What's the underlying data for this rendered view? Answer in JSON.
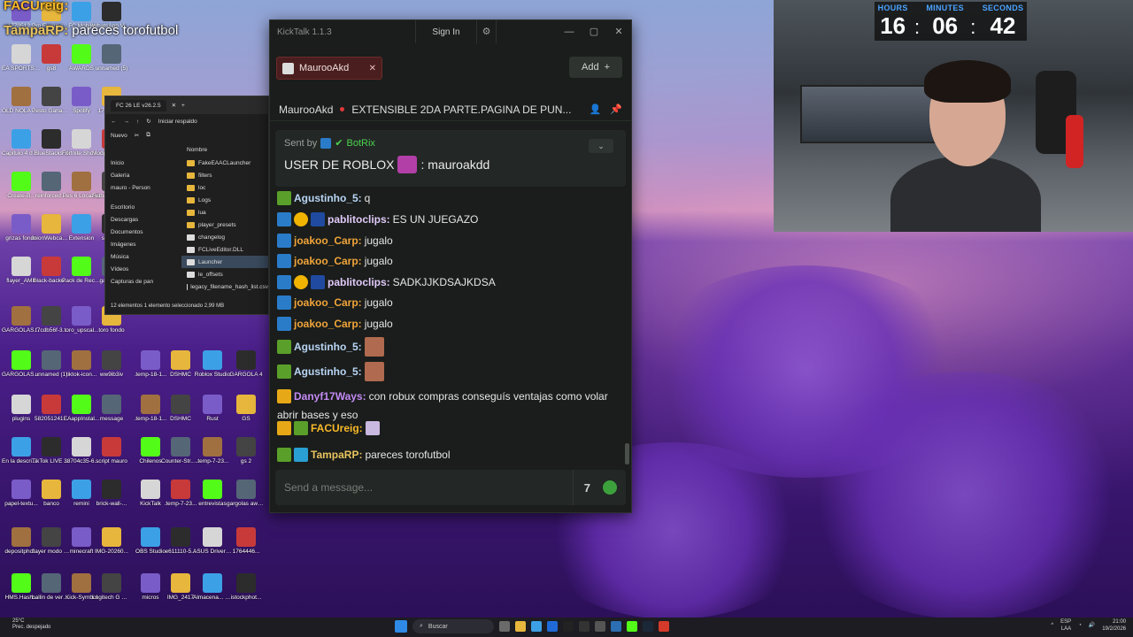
{
  "overlay": {
    "line1": {
      "name": "FACUreig:",
      "msg": ""
    },
    "line2": {
      "name": "TampaRP:",
      "msg": "parecesbtorofutbol"
    }
  },
  "desktop_icons": [
    {
      "label": "1770512..."
    },
    {
      "label": "Pro Evolution Soccer 6"
    },
    {
      "label": "FC Mobile"
    },
    {
      "label": "WhatsApp Video 2025..."
    },
    {
      "label": "EA SPORTS FC 26"
    },
    {
      "label": "gs8"
    },
    {
      "label": "AWARDS"
    },
    {
      "label": "unnamed (5)"
    },
    {
      "label": "OLD NOLA Streams"
    },
    {
      "label": "Pesto Ganadero"
    },
    {
      "label": "Spotify"
    },
    {
      "label": "1770512..."
    },
    {
      "label": "Capitulo 4 de patoamon..."
    },
    {
      "label": "BlueStacks X"
    },
    {
      "label": "Fortnite Shortcut"
    },
    {
      "label": "Modpack-HD ..."
    },
    {
      "label": "Create-B..."
    },
    {
      "label": "reinforced ..."
    },
    {
      "label": "Pes 6 Locazos"
    },
    {
      "label": "Futball x3 by Bazinga Fro..."
    },
    {
      "label": "grizas fondo"
    },
    {
      "label": "InionWebcam..."
    },
    {
      "label": "Extension"
    },
    {
      "label": "sg mice"
    },
    {
      "label": "flayer_AME"
    },
    {
      "label": "black-backu..."
    },
    {
      "label": "Pack de Recursos ..."
    },
    {
      "label": "gargola 2"
    },
    {
      "label": "GARGOLAS AWARD"
    },
    {
      "label": "f7cdb56f-3..."
    },
    {
      "label": "toro_upscal..."
    },
    {
      "label": "toro fondo"
    },
    {
      "label": ".temp-14-1..."
    },
    {
      "label": "kicktalk"
    },
    {
      "label": "pelicula l..."
    },
    {
      "label": "GARGOLA 3"
    },
    {
      "label": "GARGOLAS AWARSD"
    },
    {
      "label": "unnamed (1)"
    },
    {
      "label": "tiktok-icon..."
    },
    {
      "label": "ww9ib3iv"
    },
    {
      "label": ".temp-18-1..."
    },
    {
      "label": "DSHMC"
    },
    {
      "label": "Roblox Studio"
    },
    {
      "label": "GARGOLA 4"
    },
    {
      "label": "plugins"
    },
    {
      "label": "582051241..."
    },
    {
      "label": "EAappInstal..."
    },
    {
      "label": "message"
    },
    {
      "label": ".temp-18-1..."
    },
    {
      "label": "DSHMC"
    },
    {
      "label": "Rust"
    },
    {
      "label": "GS"
    },
    {
      "label": "En la descripció..."
    },
    {
      "label": "TikTok LIVE Studio"
    },
    {
      "label": "38704c35-6..."
    },
    {
      "label": "script mauro"
    },
    {
      "label": "Chilenos"
    },
    {
      "label": "Counter-Str... 2"
    },
    {
      "label": ".temp-7-23..."
    },
    {
      "label": "gs 2"
    },
    {
      "label": "papel-textu..."
    },
    {
      "label": "banco"
    },
    {
      "label": "remini"
    },
    {
      "label": "brick-wall-..."
    },
    {
      "label": "KickTalk"
    },
    {
      "label": ".temp-7-23..."
    },
    {
      "label": "entrevistas"
    },
    {
      "label": "gargolas awards"
    },
    {
      "label": "depositpho..."
    },
    {
      "label": "flayer modo carrera"
    },
    {
      "label": "minecraft"
    },
    {
      "label": "IMG-20260..."
    },
    {
      "label": "OBS Studio"
    },
    {
      "label": "e611110-5..."
    },
    {
      "label": "ASUS DriverHub"
    },
    {
      "label": "1764446..."
    },
    {
      "label": "HMS.Hash..."
    },
    {
      "label": "ballin de verdad"
    },
    {
      "label": "Kick-Symbol"
    },
    {
      "label": "Logitech G HUB"
    },
    {
      "label": "micros"
    },
    {
      "label": "IMG_2417"
    },
    {
      "label": "Almacena... automátic..."
    },
    {
      "label": "istockphot..."
    },
    {
      "label": "bcb2d2a5-8..."
    },
    {
      "label": "BlueStacks Multi-Insta..."
    },
    {
      "label": "al the stars mate.acd"
    },
    {
      "label": "flayer"
    },
    {
      "label": "EpicInstalle..."
    },
    {
      "label": "Steam"
    },
    {
      "label": "unnamed (3)_upscayl..."
    },
    {
      "label": "CurseForge Installer"
    },
    {
      "label": "camisetas gargolas"
    }
  ],
  "explorer": {
    "tab_label": "FC 26 LE v26.2.5",
    "address": "Iniciar respaldo",
    "new_label": "Nuevo",
    "column_header": "Nombre",
    "sidebar": [
      "Inicio",
      "Galería",
      "mauro - Person",
      "Escritorio",
      "Descargas",
      "Documentos",
      "Imágenes",
      "Música",
      "Vídeos",
      "Capturas de pan"
    ],
    "files": [
      "FakeEAACLauncher",
      "filters",
      "loc",
      "Logs",
      "lua",
      "player_presets",
      "changelog",
      "FCLiveEditor.DLL",
      "Launcher",
      "le_offsets",
      "legacy_filename_hash_list.csv"
    ],
    "status": "12 elementos    1 elemento seleccionado  2,99 MB"
  },
  "kicktalk": {
    "title": "KickTalk 1.1.3",
    "signin": "Sign In",
    "tab": "MaurooAkd",
    "add": "Add",
    "stream_user": "MaurooAkd",
    "stream_title": "EXTENSIBLE 2DA PARTE.PAGINA DE PUN...",
    "pinned": {
      "sent_by": "Sent by",
      "bot": "BotRix",
      "msg_pre": "USER DE ROBLOX",
      "msg_post": ": mauroakdd"
    },
    "messages": [
      {
        "user": "Agustinho_5:",
        "text": "q",
        "color": "#b9d5f5"
      },
      {
        "user": "pablitoclips:",
        "text": "ES UN JUEGAZO",
        "color": "#e0c8f8"
      },
      {
        "user": "joakoo_Carp:",
        "text": "jugalo",
        "color": "#f0a43a"
      },
      {
        "user": "joakoo_Carp:",
        "text": "jugalo",
        "color": "#f0a43a"
      },
      {
        "user": "pablitoclips:",
        "text": "SADKJJKDSAJKDSA",
        "color": "#e0c8f8"
      },
      {
        "user": "joakoo_Carp:",
        "text": "jugalo",
        "color": "#f0a43a"
      },
      {
        "user": "joakoo_Carp:",
        "text": "jugalo",
        "color": "#f0a43a"
      },
      {
        "user": "Agustinho_5:",
        "text": "",
        "color": "#b9d5f5"
      },
      {
        "user": "Agustinho_5:",
        "text": "",
        "color": "#b9d5f5"
      },
      {
        "user": "Danyf17Ways:",
        "text": "con robux compras conseguís ventajas como volar",
        "text2": "abrir bases y eso",
        "color": "#c48af5"
      },
      {
        "user": "FACUreig:",
        "text": "",
        "color": "#f7b92a"
      },
      {
        "user": "TampaRP:",
        "text": "pareces torofutbol",
        "color": "#e8c35f"
      }
    ],
    "input_placeholder": "Send a message..."
  },
  "clock": {
    "hours_label": "HOURS",
    "minutes_label": "MINUTES",
    "seconds_label": "SECONDS",
    "hours": "16",
    "minutes": "06",
    "seconds": "42"
  },
  "taskbar": {
    "weather_temp": "25°C",
    "weather_desc": "Prec. despejado",
    "search": "Buscar",
    "lang": "ESP",
    "lang2": "LAA",
    "time": "21:00",
    "date": "19/2/2026"
  },
  "colors": {
    "accent_kick": "#53fc18",
    "tab_active": "#4a1e1e"
  }
}
